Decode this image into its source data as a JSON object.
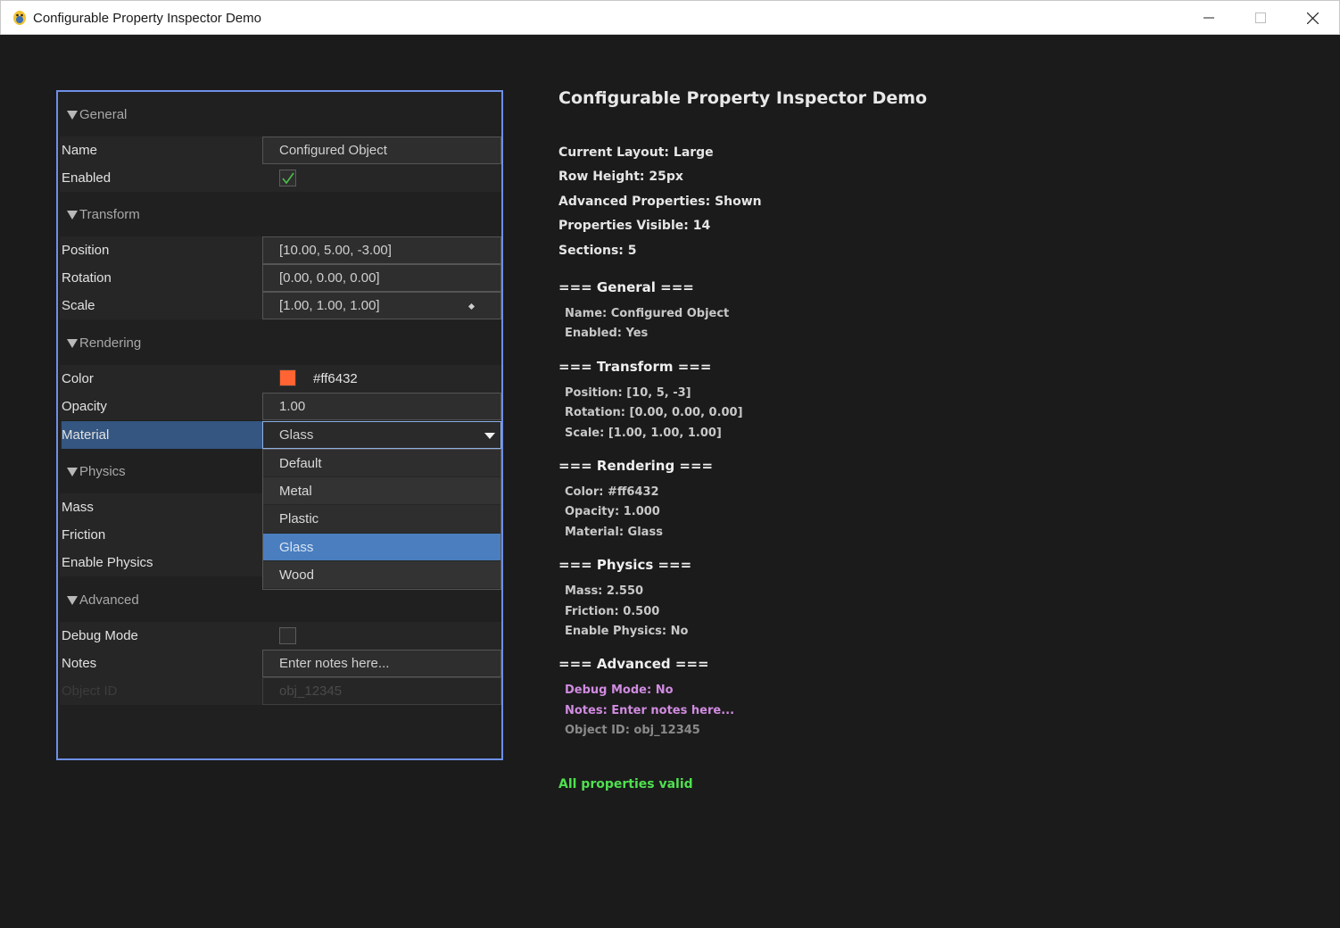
{
  "window": {
    "title": "Configurable Property Inspector Demo"
  },
  "inspector": {
    "sections": {
      "general": "General",
      "transform": "Transform",
      "rendering": "Rendering",
      "physics": "Physics",
      "advanced": "Advanced"
    },
    "properties": {
      "name": {
        "label": "Name",
        "value": "Configured Object"
      },
      "enabled": {
        "label": "Enabled",
        "checked": true
      },
      "position": {
        "label": "Position",
        "value": "[10.00, 5.00, -3.00]"
      },
      "rotation": {
        "label": "Rotation",
        "value": "[0.00, 0.00, 0.00]"
      },
      "scale": {
        "label": "Scale",
        "value": "[1.00, 1.00, 1.00]"
      },
      "color": {
        "label": "Color",
        "value": "#ff6432",
        "swatch": "#ff6432"
      },
      "opacity": {
        "label": "Opacity",
        "value": "1.00"
      },
      "material": {
        "label": "Material",
        "value": "Glass"
      },
      "mass": {
        "label": "Mass"
      },
      "friction": {
        "label": "Friction"
      },
      "enable_physics": {
        "label": "Enable Physics"
      },
      "debug_mode": {
        "label": "Debug Mode",
        "checked": false
      },
      "notes": {
        "label": "Notes",
        "value": "Enter notes here..."
      },
      "object_id": {
        "label": "Object ID",
        "value": "obj_12345"
      }
    },
    "material_options": [
      "Default",
      "Metal",
      "Plastic",
      "Glass",
      "Wood"
    ],
    "material_selected": "Glass"
  },
  "info": {
    "heading": "Configurable Property Inspector Demo",
    "stats": [
      "Current Layout: Large",
      "Row Height: 25px",
      "Advanced Properties: Shown",
      "Properties Visible: 14",
      "Sections: 5"
    ],
    "general": {
      "header": "=== General ===",
      "lines": [
        "Name: Configured Object",
        "Enabled: Yes"
      ]
    },
    "transform": {
      "header": "=== Transform ===",
      "lines": [
        "Position: [10, 5, -3]",
        "Rotation: [0.00, 0.00, 0.00]",
        "Scale: [1.00, 1.00, 1.00]"
      ]
    },
    "rendering": {
      "header": "=== Rendering ===",
      "lines": [
        "Color: #ff6432",
        "Opacity: 1.000",
        "Material: Glass"
      ]
    },
    "physics": {
      "header": "=== Physics ===",
      "lines": [
        "Mass: 2.550",
        "Friction: 0.500",
        "Enable Physics: No"
      ]
    },
    "advanced": {
      "header": "=== Advanced ===",
      "lines": [
        "Debug Mode: No",
        "Notes: Enter notes here...",
        "Object ID: obj_12345"
      ]
    },
    "status": "All properties valid"
  },
  "colors": {
    "panel_border": "#6e8fe6",
    "selected_row": "#345680",
    "dropdown_selected": "#4a7ebf",
    "status_valid": "#4fe04f",
    "advanced_text": "#d08be0"
  }
}
